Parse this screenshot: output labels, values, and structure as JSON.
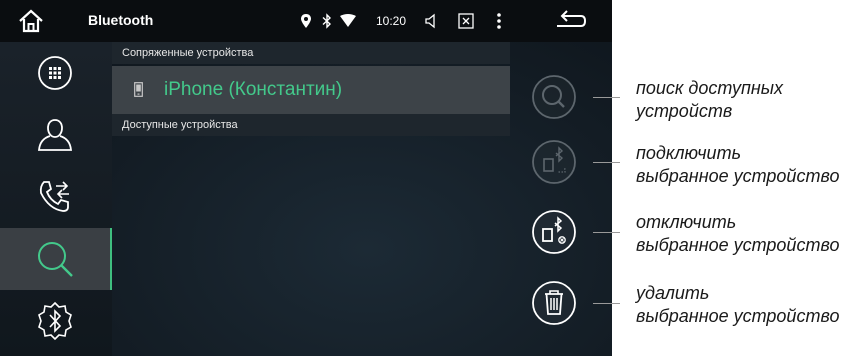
{
  "statusbar": {
    "title": "Bluetooth",
    "time": "10:20"
  },
  "sidebar": {
    "items": [
      {
        "name": "apps-grid",
        "icon": "grid-icon"
      },
      {
        "name": "contacts",
        "icon": "person-icon"
      },
      {
        "name": "call-transfer",
        "icon": "phone-transfer-icon"
      },
      {
        "name": "search",
        "icon": "search-icon",
        "active": true
      },
      {
        "name": "bluetooth-settings",
        "icon": "bluetooth-gear-icon"
      }
    ]
  },
  "main": {
    "paired_header": "Сопряженные устройства",
    "paired_device": "iPhone (Константин)",
    "available_header": "Доступные устройства"
  },
  "callouts": {
    "search_line1": "поиск доступных",
    "search_line2": "устройств",
    "connect_line1": "подключить",
    "connect_line2": "выбранное устройство",
    "disconnect_line1": "отключить",
    "disconnect_line2": "выбранное устройство",
    "delete_line1": "удалить",
    "delete_line2": "выбранное устройство"
  },
  "colors": {
    "accent": "#43c98b",
    "statusbar": "#0a0d10",
    "selected_row": "#3d4348"
  }
}
